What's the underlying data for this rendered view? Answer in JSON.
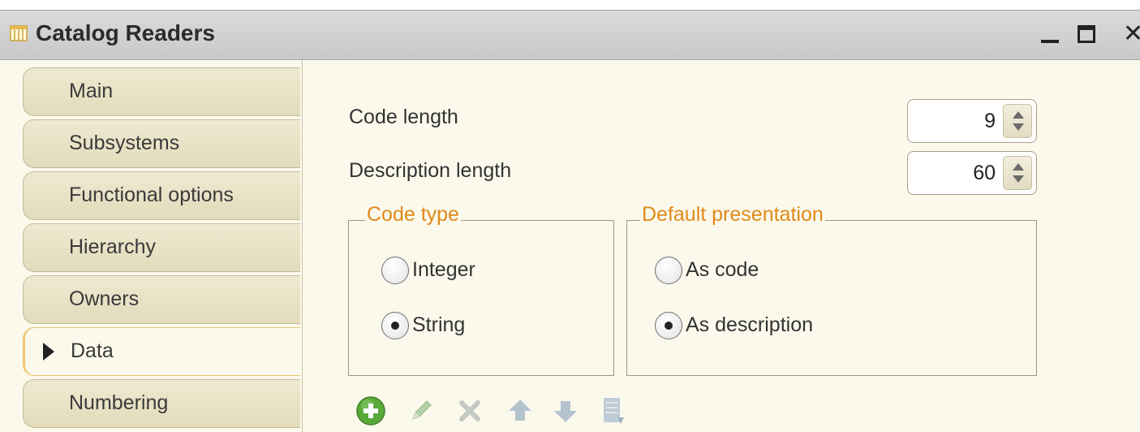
{
  "window": {
    "title": "Catalog Readers",
    "min_label": "_",
    "close_label": "✕"
  },
  "tabs": [
    {
      "label": "Main",
      "active": false
    },
    {
      "label": "Subsystems",
      "active": false
    },
    {
      "label": "Functional options",
      "active": false
    },
    {
      "label": "Hierarchy",
      "active": false
    },
    {
      "label": "Owners",
      "active": false
    },
    {
      "label": "Data",
      "active": true
    },
    {
      "label": "Numbering",
      "active": false
    }
  ],
  "fields": {
    "code_length": {
      "label": "Code length",
      "value": "9"
    },
    "description_length": {
      "label": "Description length",
      "value": "60"
    }
  },
  "code_type": {
    "title": "Code type",
    "options": [
      {
        "label": "Integer",
        "checked": false
      },
      {
        "label": "String",
        "checked": true
      }
    ]
  },
  "default_presentation": {
    "title": "Default presentation",
    "options": [
      {
        "label": "As code",
        "checked": false
      },
      {
        "label": "As description",
        "checked": true
      }
    ]
  },
  "toolbar": {
    "icons": [
      "add-icon",
      "edit-icon",
      "delete-icon",
      "move-up-icon",
      "move-down-icon",
      "list-icon"
    ]
  },
  "colors": {
    "panel_bg": "#fbf9ec",
    "group_title": "#e08a1a",
    "active_tab_accent": "#f2c66b",
    "add_green": "#5aa83a"
  }
}
